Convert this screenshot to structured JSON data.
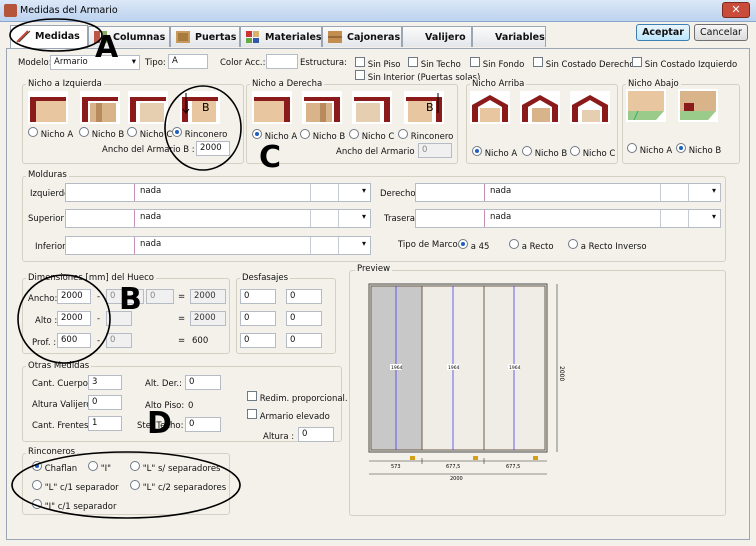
{
  "window": {
    "title": "Medidas del Armario",
    "close": "✕"
  },
  "tabs": [
    "Medidas",
    "Columnas",
    "Puertas",
    "Materiales",
    "Cajoneras",
    "Valijero",
    "Variables"
  ],
  "actions": {
    "accept": "Aceptar",
    "cancel": "Cancelar"
  },
  "top": {
    "modelo_label": "Modelo:",
    "modelo_value": "Armario",
    "tipo_label": "Tipo:",
    "tipo_value": "A",
    "color_label": "Color Acc.:",
    "color_value": "",
    "estructura_label": "Estructura:",
    "checks": [
      "Sin Piso",
      "Sin Techo",
      "Sin Fondo",
      "Sin Costado Derecho",
      "Sin Costado Izquierdo",
      "Sin Interior (Puertas solas)"
    ]
  },
  "nicho_izq": {
    "title": "Nicho a Izquierda",
    "options": [
      "Nicho A",
      "Nicho B",
      "Nicho C",
      "Rinconero"
    ],
    "selected": 3,
    "ancho_label": "Ancho del Armario B :",
    "ancho_value": "2000"
  },
  "nicho_der": {
    "title": "Nicho a Derecha",
    "options": [
      "Nicho A",
      "Nicho B",
      "Nicho C",
      "Rinconero"
    ],
    "selected": 0,
    "ancho_label": "Ancho del Armario B :",
    "ancho_value": "0"
  },
  "nicho_arriba": {
    "title": "Nicho Arriba",
    "options": [
      "Nicho A",
      "Nicho B",
      "Nicho C"
    ],
    "selected": 0
  },
  "nicho_abajo": {
    "title": "Nicho Abajo",
    "options": [
      "Nicho A",
      "Nicho B"
    ],
    "selected": 1
  },
  "thumb_letter": "B",
  "molduras": {
    "title": "Molduras",
    "izquierdo_label": "Izquierdo:",
    "izquierdo_value": "nada",
    "superior_label": "Superior :",
    "superior_value": "nada",
    "inferior_label": "Inferior:",
    "inferior_value": "nada",
    "derecho_label": "Derecho:",
    "derecho_value": "nada",
    "trasera_label": "Trasera:",
    "trasera_value": "nada",
    "marco_label": "Tipo de Marco:",
    "marco_options": [
      "a 45",
      "a Recto",
      "a Recto Inverso"
    ],
    "marco_selected": 0
  },
  "dimensiones": {
    "title": "Dimensiones [mm] del Hueco",
    "ancho_label": "Ancho:",
    "ancho": [
      "2000",
      "0",
      "0",
      "2000"
    ],
    "alto_label": "Alto :",
    "alto": [
      "2000",
      "",
      "2000"
    ],
    "prof_label": "Prof. :",
    "prof": [
      "600",
      "0",
      "600"
    ],
    "minus": "-",
    "equals": "="
  },
  "desfasajes": {
    "title": "Desfasajes",
    "values": [
      "0",
      "0",
      "0",
      "0",
      "0",
      "0"
    ]
  },
  "otras": {
    "title": "Otras Medidas",
    "cuerpos_label": "Cant. Cuerpos :",
    "cuerpos": "3",
    "valijero_label": "Altura Valijero :",
    "valijero": "0",
    "frentes_label": "Cant. Frentes :",
    "frentes": "1",
    "altder_label": "Alt. Der.:",
    "altder": "0",
    "altpiso_label": "Alto Piso:",
    "altpiso": "0",
    "stetecho_label": "Ste. Techo:",
    "stetecho": "0",
    "redim_label": "Redim. proporcional.",
    "elevado_label": "Armario elevado",
    "altura_label": "Altura :",
    "altura": "0"
  },
  "rinconeros": {
    "title": "Rinconeros",
    "options": [
      "Chaflan",
      "\"I\"",
      "\"L\" s/ separadores",
      "\"L\" c/1 separador",
      "\"L\" c/2 separadores",
      "\"I\" c/1 separador"
    ],
    "selected": 0
  },
  "preview": {
    "title": "Preview",
    "height_label": "2000",
    "door_labels": [
      "1964",
      "1964",
      "1964"
    ],
    "bottom_widths": [
      "573",
      "677,5",
      "677,5"
    ],
    "total_width": "2000"
  },
  "callouts": {
    "a": "A",
    "b": "B",
    "c": "C",
    "d": "D"
  }
}
